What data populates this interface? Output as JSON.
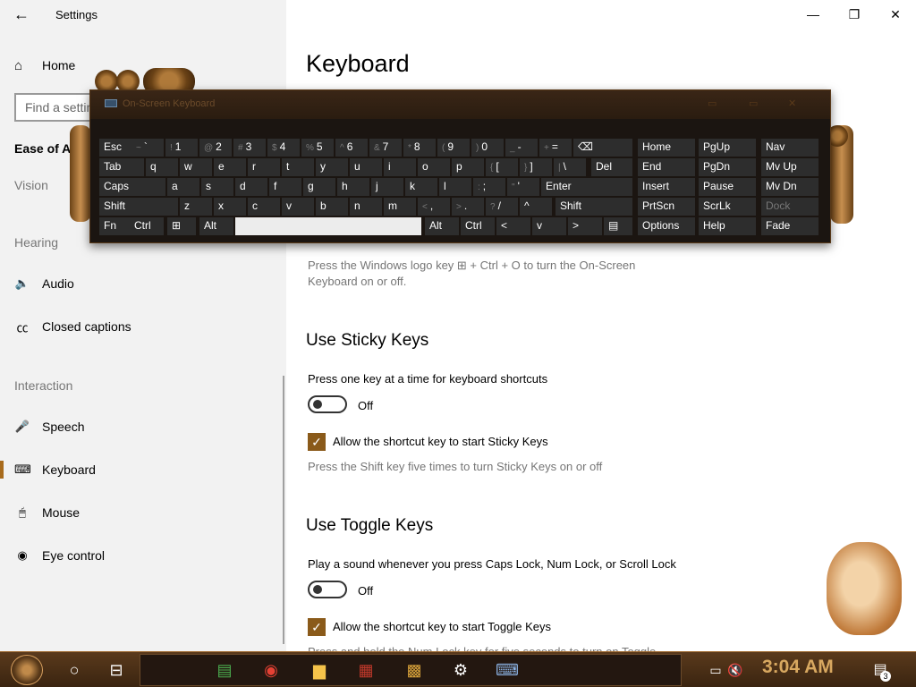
{
  "window": {
    "title": "Settings",
    "minimize": "—",
    "restore": "❐",
    "close": "✕"
  },
  "sidebar": {
    "back": "←",
    "home": {
      "icon": "⌂",
      "label": "Home"
    },
    "search_placeholder": "Find a setting",
    "category_title": "Ease of Access",
    "sections": [
      {
        "label": "Vision"
      },
      {
        "label": "Hearing"
      },
      {
        "label": "Interaction"
      }
    ],
    "items": [
      {
        "icon": "🔈",
        "label": "Audio"
      },
      {
        "icon": "㏄",
        "label": "Closed captions"
      },
      {
        "icon": "🎤",
        "label": "Speech"
      },
      {
        "icon": "⌨",
        "label": "Keyboard"
      },
      {
        "icon": "🖱",
        "label": "Mouse"
      },
      {
        "icon": "◉",
        "label": "Eye control"
      }
    ]
  },
  "main": {
    "page_title": "Keyboard",
    "osk_hint_1": "Press the Windows logo key ⊞ + Ctrl + O to turn the On-Screen",
    "osk_hint_2": "Keyboard on or off.",
    "sticky": {
      "title": "Use Sticky Keys",
      "desc": "Press one key at a time for keyboard shortcuts",
      "toggle_state": "Off",
      "checkbox_label": "Allow the shortcut key to start Sticky Keys",
      "hint": "Press the Shift key five times to turn Sticky Keys on or off"
    },
    "toggle_keys": {
      "title": "Use Toggle Keys",
      "desc": "Play a sound whenever you press Caps Lock, Num Lock, or Scroll Lock",
      "toggle_state": "Off",
      "checkbox_label": "Allow the shortcut key to start Toggle Keys",
      "hint": "Press and hold the Num Lock key for five seconds to turn on Toggle"
    }
  },
  "osk": {
    "title": "On-Screen Keyboard",
    "rows": [
      [
        {
          "main": "Esc"
        },
        {
          "sub": "~",
          "main": "`"
        },
        {
          "sub": "!",
          "main": "1"
        },
        {
          "sub": "@",
          "main": "2"
        },
        {
          "sub": "#",
          "main": "3"
        },
        {
          "sub": "$",
          "main": "4"
        },
        {
          "sub": "%",
          "main": "5"
        },
        {
          "sub": "^",
          "main": "6"
        },
        {
          "sub": "&",
          "main": "7"
        },
        {
          "sub": "*",
          "main": "8"
        },
        {
          "sub": "(",
          "main": "9"
        },
        {
          "sub": ")",
          "main": "0"
        },
        {
          "sub": "_",
          "main": "-"
        },
        {
          "sub": "+",
          "main": "="
        },
        {
          "main": "⌫"
        }
      ],
      [
        {
          "main": "Tab"
        },
        {
          "main": "q"
        },
        {
          "main": "w"
        },
        {
          "main": "e"
        },
        {
          "main": "r"
        },
        {
          "main": "t"
        },
        {
          "main": "y"
        },
        {
          "main": "u"
        },
        {
          "main": "i"
        },
        {
          "main": "o"
        },
        {
          "main": "p"
        },
        {
          "sub": "{",
          "main": "["
        },
        {
          "sub": "}",
          "main": "]"
        },
        {
          "sub": "|",
          "main": "\\"
        },
        {
          "main": "Del"
        }
      ],
      [
        {
          "main": "Caps"
        },
        {
          "main": "a"
        },
        {
          "main": "s"
        },
        {
          "main": "d"
        },
        {
          "main": "f"
        },
        {
          "main": "g"
        },
        {
          "main": "h"
        },
        {
          "main": "j"
        },
        {
          "main": "k"
        },
        {
          "main": "l"
        },
        {
          "sub": ":",
          "main": ";"
        },
        {
          "sub": "\"",
          "main": "'"
        },
        {
          "main": "Enter"
        }
      ],
      [
        {
          "main": "Shift"
        },
        {
          "main": "z"
        },
        {
          "main": "x"
        },
        {
          "main": "c"
        },
        {
          "main": "v"
        },
        {
          "main": "b"
        },
        {
          "main": "n"
        },
        {
          "main": "m"
        },
        {
          "sub": "<",
          "main": ","
        },
        {
          "sub": ">",
          "main": "."
        },
        {
          "sub": "?",
          "main": "/"
        },
        {
          "main": "^"
        },
        {
          "main": "Shift"
        }
      ],
      [
        {
          "main": "Fn"
        },
        {
          "main": "Ctrl"
        },
        {
          "main": "⊞"
        },
        {
          "main": "Alt"
        },
        {
          "main": ""
        },
        {
          "main": "Alt"
        },
        {
          "main": "Ctrl"
        },
        {
          "main": "<"
        },
        {
          "main": "v"
        },
        {
          "main": ">"
        },
        {
          "main": "▤"
        }
      ]
    ],
    "nav_keys": [
      [
        "Home",
        "PgUp",
        "Nav"
      ],
      [
        "End",
        "PgDn",
        "Mv Up"
      ],
      [
        "Insert",
        "Pause",
        "Mv Dn"
      ],
      [
        "PrtScn",
        "ScrLk",
        "Dock"
      ],
      [
        "Options",
        "Help",
        "Fade"
      ]
    ]
  },
  "taskbar": {
    "time": "3:04 AM",
    "notification_count": "3",
    "icons": [
      "start-orb",
      "cortana-circle",
      "task-view",
      "sticky-notes",
      "chrome",
      "file-explorer",
      "media-app",
      "game-app",
      "settings-gear",
      "on-screen-keyboard"
    ]
  }
}
